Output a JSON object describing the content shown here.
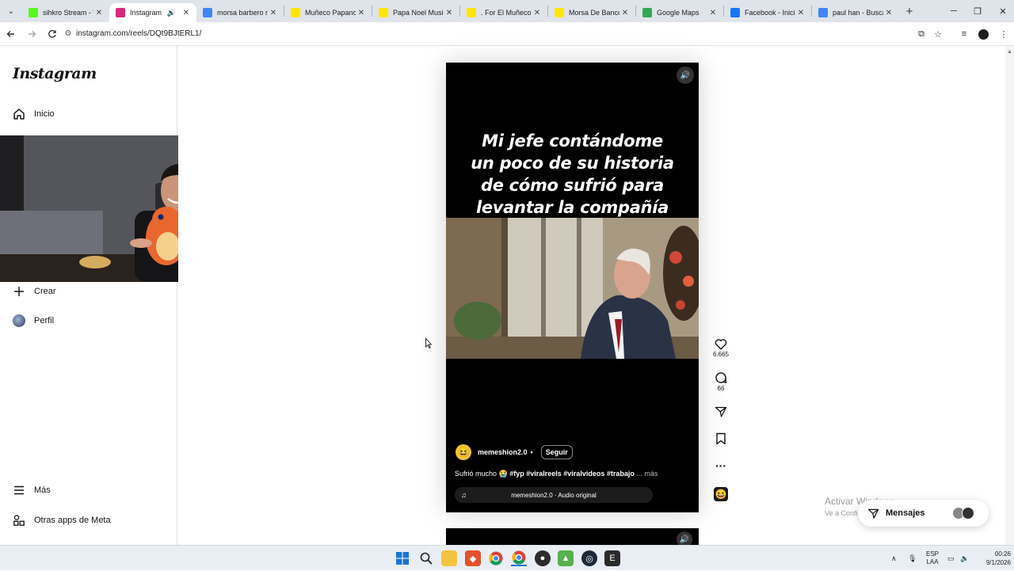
{
  "browser": {
    "tabs": [
      {
        "label": "sihkro Stream - W",
        "favicon": "kick-icon",
        "favicon_color": "#53fc18",
        "active": false
      },
      {
        "label": "Instagram",
        "favicon": "instagram-icon",
        "favicon_color": "#d62976",
        "active": true,
        "audio": true
      },
      {
        "label": "morsa barbero n",
        "favicon": "google-icon",
        "favicon_color": "#4285f4",
        "active": false
      },
      {
        "label": "Muñeco Papano",
        "favicon": "mercadolibre-icon",
        "favicon_color": "#ffe600",
        "active": false
      },
      {
        "label": "Papa Noel Music",
        "favicon": "mercadolibre-icon",
        "favicon_color": "#ffe600",
        "active": false
      },
      {
        "label": ". For El Muñeco D",
        "favicon": "mercadolibre-icon",
        "favicon_color": "#ffe600",
        "active": false
      },
      {
        "label": "Morsa De Banco",
        "favicon": "mercadolibre-icon",
        "favicon_color": "#ffe600",
        "active": false
      },
      {
        "label": "Google Maps",
        "favicon": "maps-icon",
        "favicon_color": "#34a853",
        "active": false
      },
      {
        "label": "Facebook - Inicia",
        "favicon": "facebook-icon",
        "favicon_color": "#1877f2",
        "active": false
      },
      {
        "label": "paul han - Busca",
        "favicon": "google-icon",
        "favicon_color": "#4285f4",
        "active": false
      }
    ],
    "url": "instagram.com/reels/DQt9BJtERL1/"
  },
  "sidebar": {
    "logo": "Instagram",
    "items": [
      {
        "label": "Inicio",
        "icon": "home-icon"
      },
      {
        "label": "Crear",
        "icon": "plus-icon"
      },
      {
        "label": "Perfil",
        "icon": "avatar"
      },
      {
        "label": "Más",
        "icon": "menu-icon"
      },
      {
        "label": "Otras apps de Meta",
        "icon": "meta-apps-icon"
      }
    ]
  },
  "reel": {
    "overlay_text": "Mi jefe contándome un poco de su historia de cómo sufrió para levantar la compañía",
    "username": "memeshion2.0",
    "separator": "•",
    "follow_label": "Seguir",
    "caption_text": "Sufrió mucho 😭",
    "caption_tags": "#fyp #viralreels #viralvideos #trabajo",
    "caption_more": "... más",
    "audio": "memeshion2.0 · Audio original"
  },
  "actions": {
    "likes": "6.665",
    "comments": "66"
  },
  "windows_watermark": {
    "title": "Activar Windows",
    "subtitle": "Ve a Configuración para activar Windows."
  },
  "messages": {
    "label": "Mensajes"
  },
  "taskbar": {
    "lang_top": "ESP",
    "lang_bottom": "LAA",
    "time": "00:26",
    "date": "9/1/2026"
  }
}
